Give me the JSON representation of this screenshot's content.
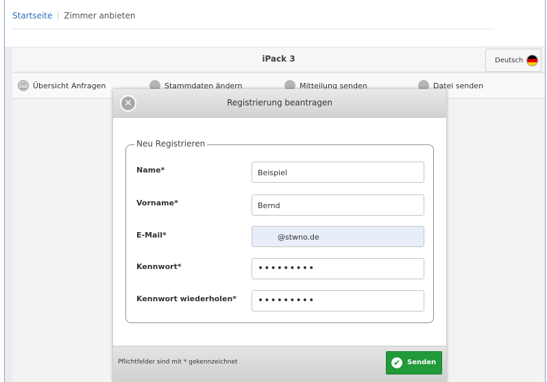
{
  "breadcrumb": {
    "home": "Startseite",
    "current": "Zimmer anbieten"
  },
  "app": {
    "title": "iPack 3"
  },
  "language": {
    "label": "Deutsch",
    "flag_icon": "german-flag-icon",
    "flag_colors": [
      "#000000",
      "#dd0000",
      "#ffce00"
    ]
  },
  "nav": {
    "items": [
      {
        "label": "Übersicht Anfragen",
        "icon": "calendar-icon"
      },
      {
        "label": "Stammdaten ändern",
        "icon": "user-icon"
      },
      {
        "label": "Mitteilung senden",
        "icon": "mail-icon"
      },
      {
        "label": "Datei senden",
        "icon": "upload-icon"
      }
    ]
  },
  "dialog": {
    "title": "Registrierung beantragen",
    "close_icon": "close-icon",
    "fieldset_legend": "Neu Registrieren",
    "fields": [
      {
        "label": "Name*",
        "value": "Beispiel"
      },
      {
        "label": "Vorname*",
        "value": "Bernd"
      },
      {
        "label": "E-Mail*",
        "value": "@stwno.de"
      },
      {
        "label": "Kennwort*",
        "value": "•••••••••"
      },
      {
        "label": "Kennwort wiederholen*",
        "value": "•••••••••"
      }
    ],
    "footer_note": "Pflichtfelder sind mit * gekennzeichnet",
    "submit_label": "Senden",
    "submit_icon": "checkmark-icon",
    "accent_color": "#219a3a"
  }
}
